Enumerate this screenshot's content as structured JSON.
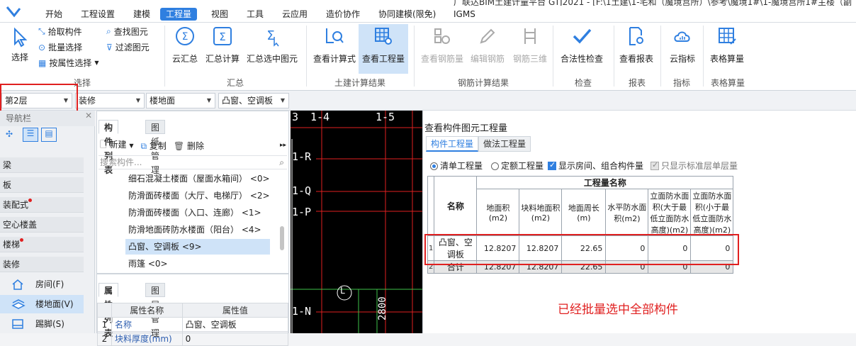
{
  "window": {
    "title": "广联达BIM土建计量平台 GTJ2021 - [F:\\1土建\\1-宅和（魔境宫所）\\参考\\魔境1#\\1-魔境宫所1#主楼（副"
  },
  "menu": [
    "开始",
    "工程设置",
    "建模",
    "工程量",
    "视图",
    "工具",
    "云应用",
    "造价协作",
    "协同建模(限免)",
    "IGMS"
  ],
  "ribbon": {
    "select_group": {
      "big": "选择",
      "pick": "拾取构件",
      "batch": "批量选择",
      "by_attr": "按属性选择",
      "find": "查找图元",
      "filter": "过滤图元",
      "label": "选择"
    },
    "summary_group": {
      "cloud": "云汇总",
      "calc": "汇总计算",
      "selected": "汇总选中图元",
      "label": "汇总"
    },
    "civil_group": {
      "formula": "查看计算式",
      "quantity": "查看工程量",
      "label": "土建计算结果"
    },
    "rebar_group": {
      "view": "查看钢筋量",
      "edit": "编辑钢筋",
      "three_d": "钢筋三维",
      "label": "钢筋计算结果"
    },
    "check_group": {
      "legal": "合法性检查",
      "label": "检查"
    },
    "report_group": {
      "report": "查看报表",
      "label": "报表"
    },
    "index_group": {
      "cloud_index": "云指标",
      "label": "指标"
    },
    "table_group": {
      "table": "表格算量",
      "label": "表格算量"
    }
  },
  "selectors": {
    "floor": "第2层",
    "category": "装修",
    "type": "楼地面",
    "component": "凸窗、空调板"
  },
  "nav": {
    "title": "导航栏",
    "categories": [
      "梁",
      "板",
      "装配式",
      "空心楼盖",
      "楼梯",
      "装修"
    ],
    "subitems": [
      "房间(F)",
      "楼地面(V)",
      "踢脚(S)"
    ]
  },
  "components": {
    "tabs": [
      "构件列表",
      "图纸管理"
    ],
    "new": "新建",
    "copy": "复制",
    "delete": "删除",
    "search_placeholder": "搜索构件...",
    "items": [
      "细石混凝土楼面（屋面水箱间） <0>",
      "防滑面砖楼面（大厅、电梯厅） <2>",
      "防滑面砖楼面（入口、连廊） <1>",
      "防滑地面砖防水楼面（阳台） <4>",
      "凸窗、空调板 <9>",
      "雨篷 <0>"
    ]
  },
  "attributes": {
    "tabs": [
      "属性列表",
      "图层管理"
    ],
    "col_name": "属性名称",
    "col_value": "属性值",
    "rows": [
      {
        "no": "1",
        "name": "名称",
        "value": "凸窗、空调板"
      },
      {
        "no": "2",
        "name": "块料厚度(mm)",
        "value": "0"
      }
    ]
  },
  "cad": {
    "labels": [
      "3",
      "1-4",
      "1-5",
      "1-R",
      "1-Q",
      "1-P",
      "1-N",
      "L",
      "2800"
    ]
  },
  "dialog": {
    "title": "查看构件图元工程量",
    "tabs": [
      "构件工程量",
      "做法工程量"
    ],
    "options": {
      "list_qty": "清单工程量",
      "quota_qty": "定额工程量",
      "show_rooms": "显示房间、组合构件量",
      "std_floor": "只显示标准层单层量"
    },
    "table": {
      "group_header": "工程量名称",
      "name_header": "名称",
      "columns": [
        "地面积(m2)",
        "块料地面积(m2)",
        "地面周长(m)",
        "水平防水面积(m2)",
        "立面防水面积(大于最低立面防水高度)(m2)",
        "立面防水面积(小于最低立面防水高度)(m2)"
      ],
      "rows": [
        {
          "no": "1",
          "name": "凸窗、空调板",
          "values": [
            "12.8207",
            "12.8207",
            "22.65",
            "0",
            "0",
            "0"
          ]
        },
        {
          "no": "2",
          "name": "合计",
          "values": [
            "12.8207",
            "12.8207",
            "22.65",
            "0",
            "0",
            "0"
          ]
        }
      ]
    },
    "note": "已经批量选中全部构件"
  },
  "colors": {
    "accent": "#2f7fe0",
    "highlight": "#e02020"
  }
}
